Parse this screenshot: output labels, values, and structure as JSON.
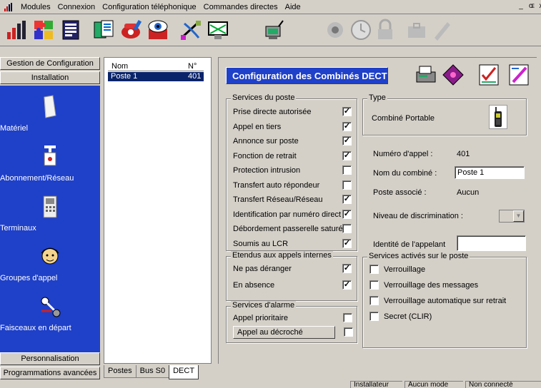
{
  "menubar": {
    "items": [
      "Modules",
      "Connexion",
      "Configuration téléphonique",
      "Commandes directes",
      "Aide"
    ],
    "window_controls": [
      "_",
      "ɶ",
      "x"
    ]
  },
  "toolbar": {
    "icons": [
      "signal-bars-icon",
      "puzzle-icon",
      "book-list-icon",
      "module-icon",
      "phone-tools-icon",
      "eye-gear-icon",
      "cable-icon",
      "network-icon",
      "pc-antenna-icon",
      "sun-disc-icon",
      "clock-icon",
      "lock-icon",
      "lock-case-icon",
      "pen-icon"
    ]
  },
  "leftnav": {
    "top_buttons": [
      "Gestion de Configuration",
      "Installation"
    ],
    "tools": [
      {
        "label": "Matériel",
        "icon": "hardware-panel-icon"
      },
      {
        "label": "Abonnement/Réseau",
        "icon": "network-plug-icon"
      },
      {
        "label": "Terminaux",
        "icon": "terminal-phone-icon"
      },
      {
        "label": "Groupes d'appel",
        "icon": "group-person-icon"
      },
      {
        "label": "Faisceaux en départ",
        "icon": "trunk-key-icon"
      }
    ],
    "bottom_buttons": [
      "Personnalisation",
      "Programmations avancées"
    ]
  },
  "list": {
    "columns": [
      "Nom",
      "N°"
    ],
    "rows": [
      {
        "name": "Poste 1",
        "number": "401"
      }
    ],
    "tabs": [
      "Postes",
      "Bus S0",
      "DECT"
    ],
    "active_tab": "DECT"
  },
  "main": {
    "title": "Configuration des Combinés DECT",
    "services_poste": {
      "title": "Services du poste",
      "items": [
        {
          "label": "Prise directe autorisée",
          "checked": true
        },
        {
          "label": "Appel en tiers",
          "checked": true
        },
        {
          "label": "Annonce sur poste",
          "checked": true
        },
        {
          "label": "Fonction de retrait",
          "checked": true
        },
        {
          "label": "Protection intrusion",
          "checked": false
        },
        {
          "label": "Transfert auto répondeur",
          "checked": false
        },
        {
          "label": "Transfert Réseau/Réseau",
          "checked": true
        },
        {
          "label": "Identification par numéro direct",
          "checked": true
        },
        {
          "label": "Débordement passerelle saturée",
          "checked": false
        },
        {
          "label": "Soumis au LCR",
          "checked": true
        }
      ]
    },
    "etendus": {
      "title": "Etendus aux appels internes",
      "items": [
        {
          "label": "Ne pas déranger",
          "checked": true
        },
        {
          "label": "En absence",
          "checked": true
        }
      ]
    },
    "alarme": {
      "title": "Services d'alarme",
      "items": [
        {
          "label": "Appel prioritaire",
          "checked": false
        }
      ],
      "button": "Appel au décroché",
      "button_checked": false
    },
    "type": {
      "title": "Type",
      "value": "Combiné Portable"
    },
    "info": {
      "numero_label": "Numéro d'appel :",
      "numero_value": "401",
      "nom_label": "Nom du combiné :",
      "nom_value": "Poste 1",
      "associe_label": "Poste associé :",
      "associe_value": "Aucun",
      "discrimination_label": "Niveau de discrimination :",
      "discrimination_value": "",
      "appelant_label": "Identité de l'appelant",
      "appelant_value": ""
    },
    "services_actives": {
      "title": "Services activés sur le poste",
      "items": [
        {
          "label": "Verrouillage",
          "checked": false
        },
        {
          "label": "Verrouillage des messages",
          "checked": false
        },
        {
          "label": "Verrouillage automatique sur retrait",
          "checked": false
        },
        {
          "label": "Secret  (CLIR)",
          "checked": false
        }
      ]
    }
  },
  "status": {
    "cells": [
      "Installateur",
      "Aucun mode",
      "Non connecté"
    ]
  },
  "colors": {
    "nav_blue": "#1f40c8",
    "selection": "#0a246a",
    "face": "#d4d0c8"
  }
}
